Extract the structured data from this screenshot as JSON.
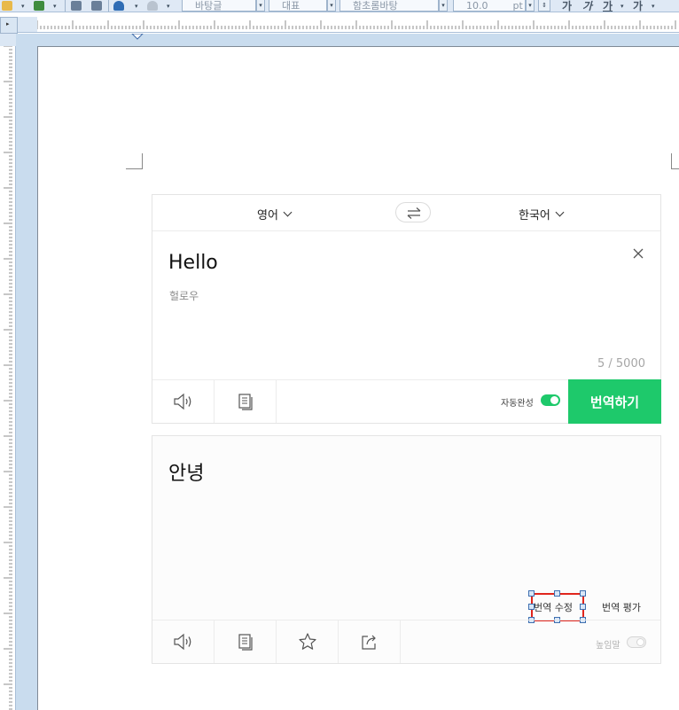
{
  "toolbar": {
    "style_name": "바탕글",
    "outline_name": "대표",
    "font_name": "함초롬바탕",
    "font_size": "10.0",
    "font_unit": "pt",
    "bold_label": "가",
    "italic_label": "가",
    "underline_label": "가",
    "strike_label": "가"
  },
  "translator": {
    "source_lang": "영어",
    "target_lang": "한국어",
    "source_text": "Hello",
    "pronunciation": "헐로우",
    "char_count": "5 / 5000",
    "autocomplete_label": "자동완성",
    "autocomplete_on": true,
    "translate_button": "번역하기",
    "target_text": "안녕",
    "edit_translation": "번역 수정",
    "rate_translation": "번역 평가",
    "honorific_label": "높임말",
    "honorific_on": false,
    "accent_color": "#1ec96b"
  },
  "icons": {
    "speaker": "speaker-icon",
    "copy": "copy-icon",
    "star": "star-icon",
    "share": "share-icon",
    "swap": "swap-icon",
    "close": "close-icon"
  }
}
